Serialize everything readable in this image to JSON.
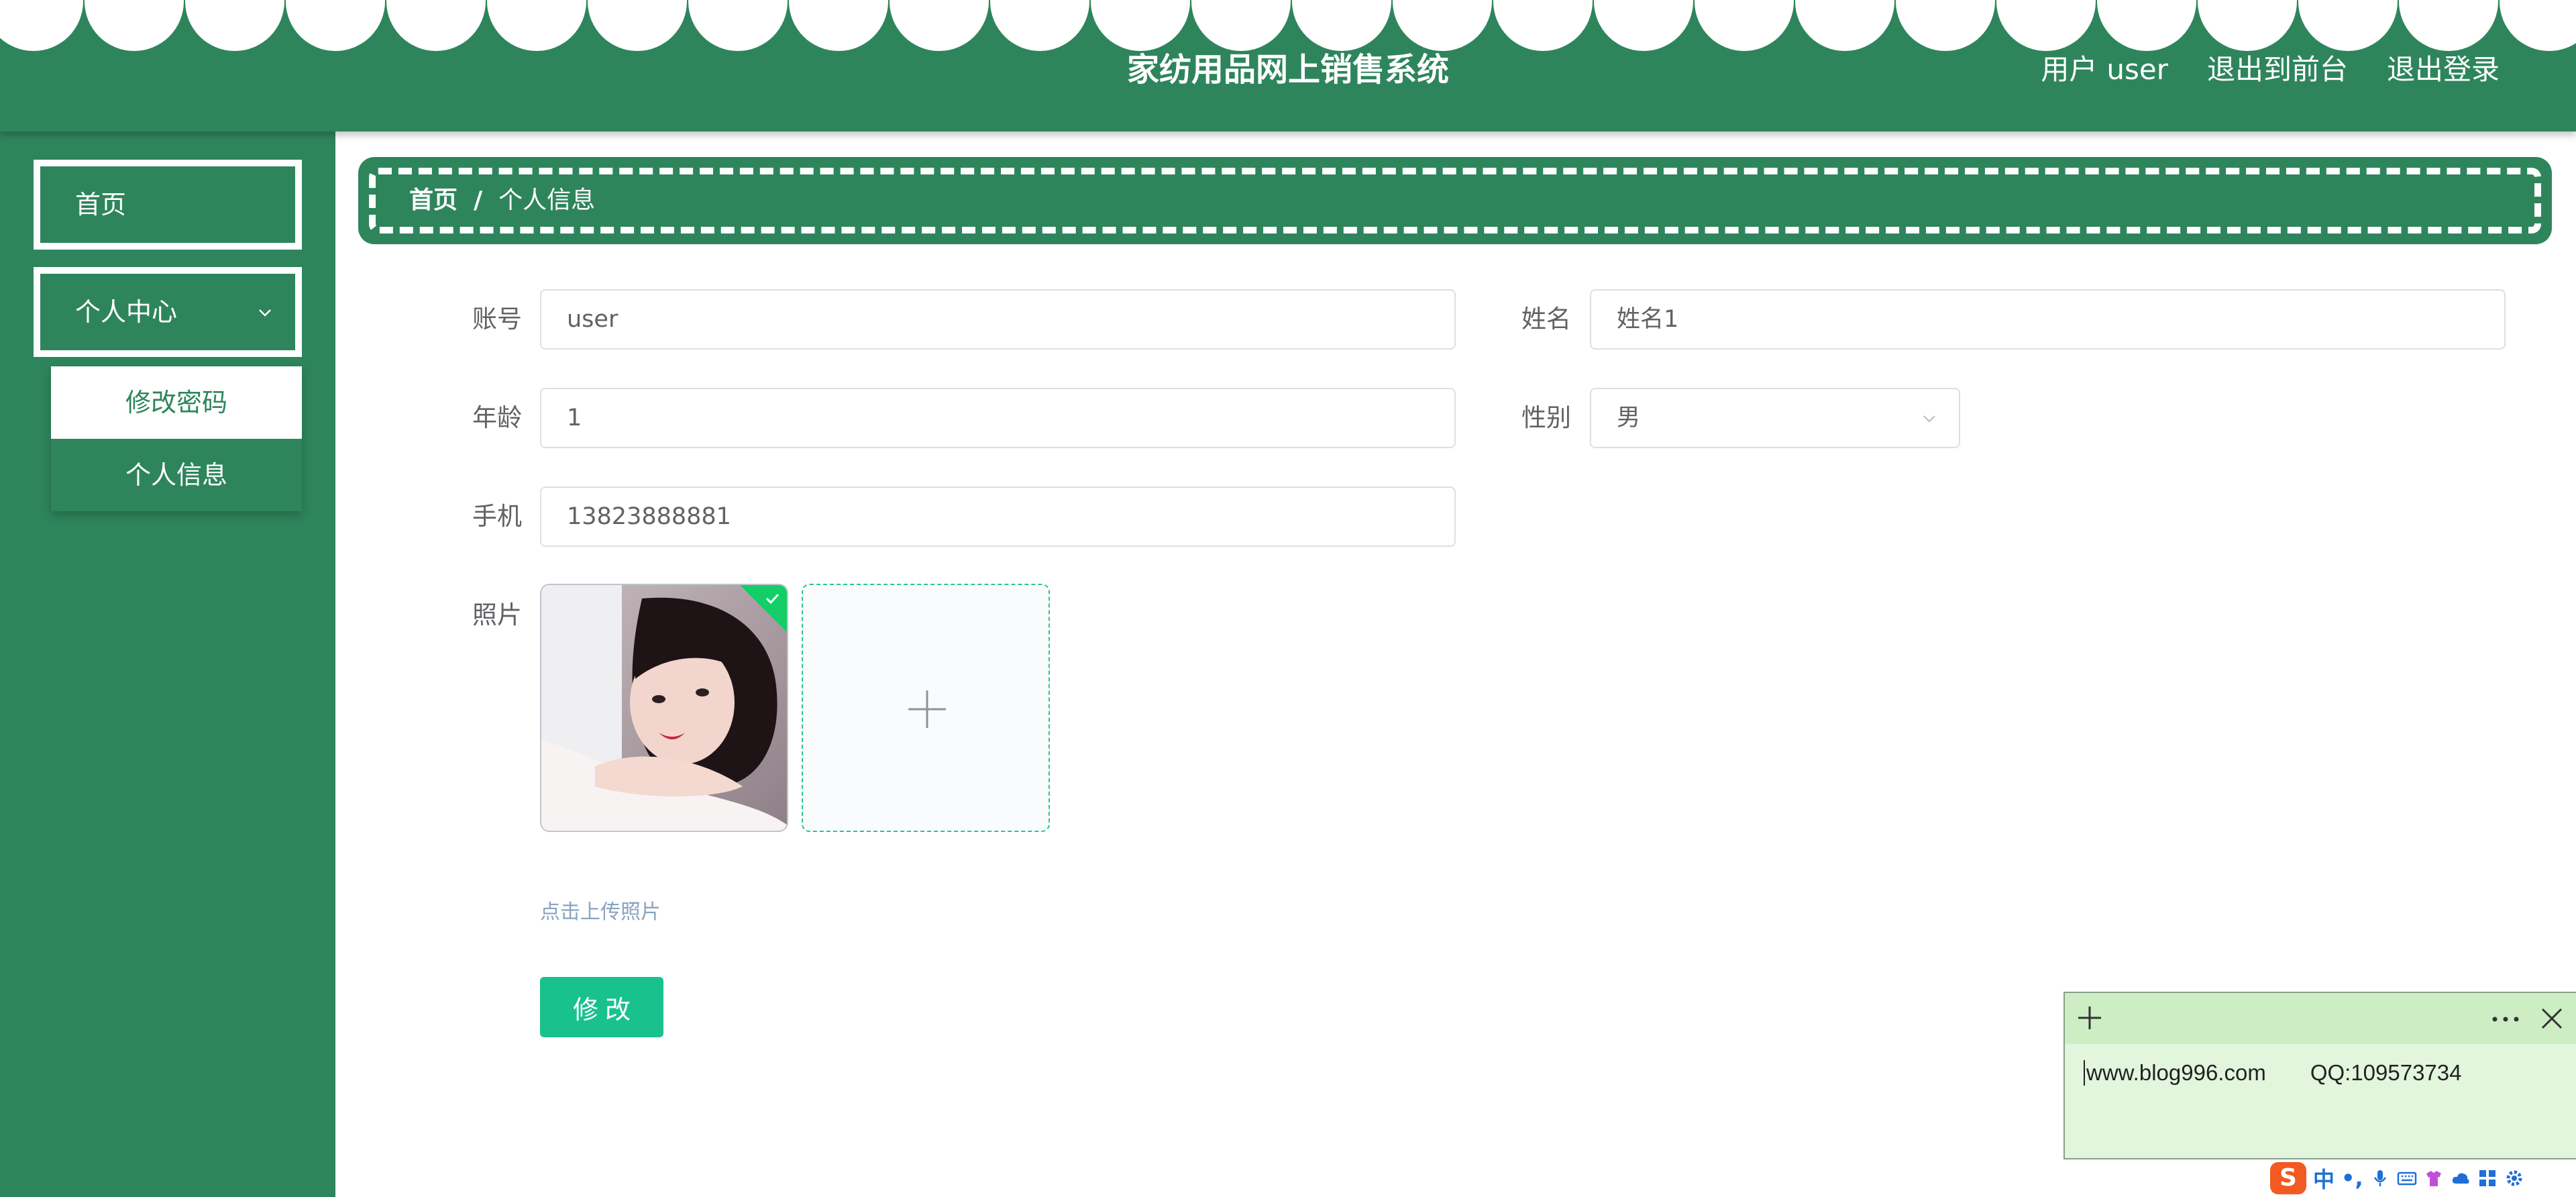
{
  "header": {
    "title": "家纺用品网上销售系统",
    "user_prefix": "用户",
    "username": "user",
    "back_to_front": "退出到前台",
    "logout": "退出登录"
  },
  "sidebar": {
    "home": "首页",
    "personal_center": "个人中心",
    "submenu": [
      "修改密码",
      "个人信息"
    ]
  },
  "breadcrumb": {
    "home": "首页",
    "separator": "/",
    "current": "个人信息"
  },
  "form": {
    "account_label": "账号",
    "account_value": "user",
    "name_label": "姓名",
    "name_value": "姓名1",
    "age_label": "年龄",
    "age_value": "1",
    "gender_label": "性别",
    "gender_value": "男",
    "phone_label": "手机",
    "phone_value": "13823888881",
    "photo_label": "照片",
    "upload_tip": "点击上传照片",
    "submit_label": "修改"
  },
  "sticky_note": {
    "website": "www.blog996.com",
    "qq": "QQ:109573734"
  },
  "ime": {
    "logo": "S",
    "mode": "中",
    "punct": "•,"
  },
  "colors": {
    "primary_green": "#2e855c",
    "button_teal": "#19c28d",
    "success_green": "#13ce66",
    "note_bg": "#e1f6dc"
  },
  "icons": [
    "chevron-down-icon",
    "select-arrow-icon",
    "check-icon",
    "plus-icon",
    "note-plus-icon",
    "more-icon",
    "close-icon"
  ]
}
